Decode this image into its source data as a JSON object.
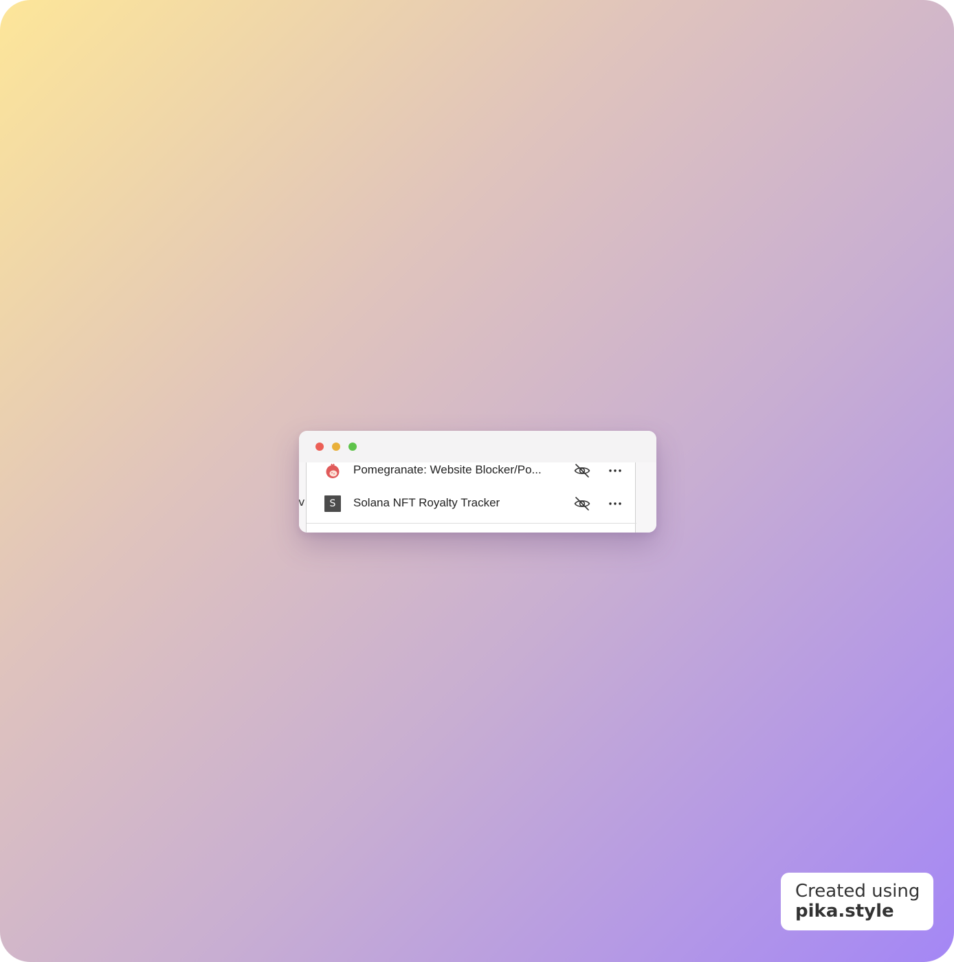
{
  "window": {
    "traffic_lights": {
      "close_color": "#ec5f56",
      "minimize_color": "#e9b03a",
      "maximize_color": "#5ec34a"
    },
    "left_fragment_text": "vi"
  },
  "extensions": [
    {
      "name": "Pomegranate: Website Blocker/Po...",
      "icon": "pomegranate-icon",
      "visibility_icon": "eye-off-icon",
      "menu_icon": "more-horizontal-icon"
    },
    {
      "name": "Solana NFT Royalty Tracker",
      "icon": "s-letter-icon",
      "icon_letter": "S",
      "visibility_icon": "eye-off-icon",
      "menu_icon": "more-horizontal-icon"
    }
  ],
  "badge": {
    "line1": "Created using",
    "line2": "pika.style"
  },
  "colors": {
    "gradient_start": "#fde699",
    "gradient_end": "#a487f5",
    "pomegranate": "#e05a5a"
  }
}
